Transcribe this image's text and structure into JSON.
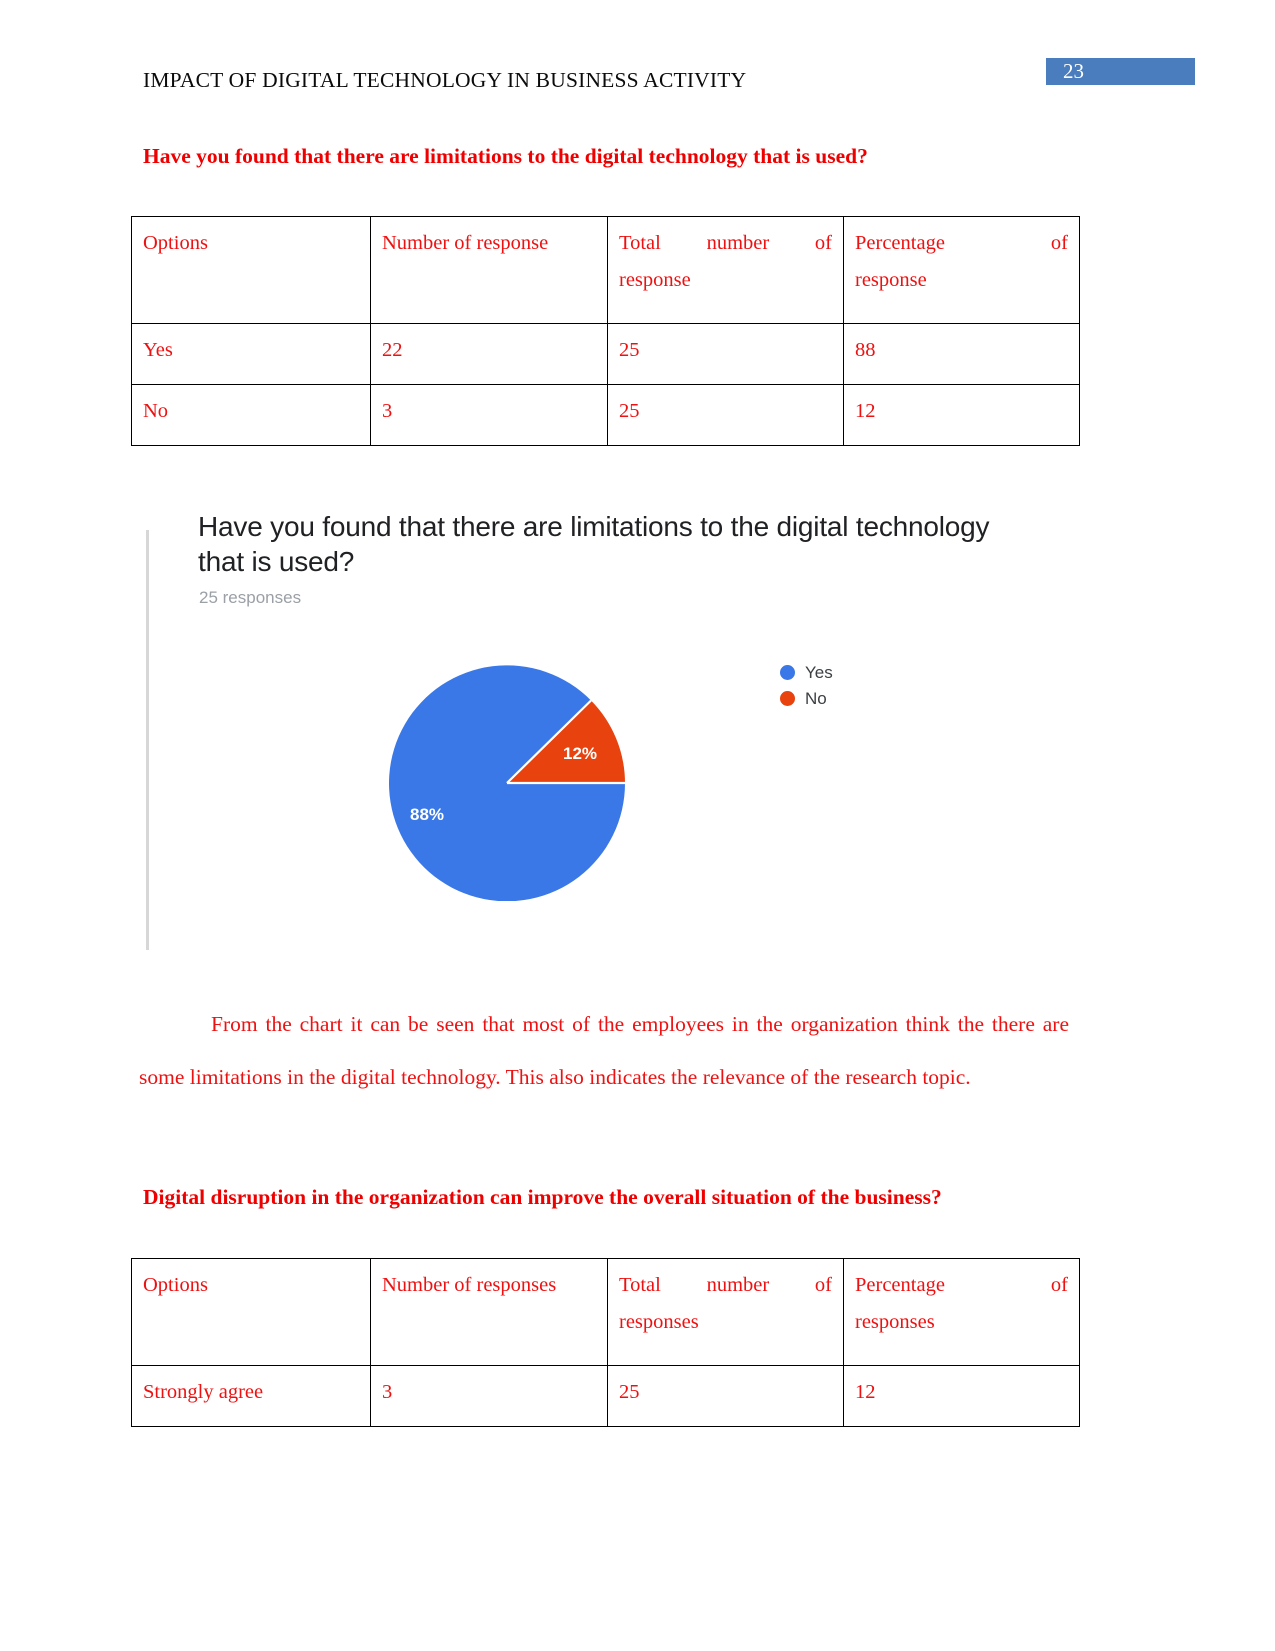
{
  "document": {
    "running_head": "IMPACT OF DIGITAL TECHNOLOGY IN BUSINESS ACTIVITY",
    "page_number": "23",
    "page_badge_color": "#4a7dbd",
    "body_text_color": "#ee1111"
  },
  "section_1": {
    "heading": "Have you found that there are limitations to the digital technology that is used?",
    "table": {
      "headers": {
        "col1": "Options",
        "col2": "Number of response",
        "col3_line1": "Total number of",
        "col3_line2": "response",
        "col4_line1": "Percentage of",
        "col4_line2": "response"
      },
      "rows": [
        {
          "option": "Yes",
          "number_of_response": "22",
          "total_number": "25",
          "percentage": "88"
        },
        {
          "option": "No",
          "number_of_response": "3",
          "total_number": "25",
          "percentage": "12"
        }
      ]
    },
    "chart_card": {
      "question": "Have you found that there are limitations to the digital technology that is used?",
      "responses_label": "25 responses",
      "slice_label_yes": "88%",
      "slice_label_no": "12%",
      "legend": [
        {
          "label": "Yes",
          "color": "#3b78e7"
        },
        {
          "label": "No",
          "color": "#e8420e"
        }
      ]
    },
    "paragraph": "From the  chart it can be seen that most of the employees in the organization think the there are some limitations in the digital technology. This also  indicates the relevance of the research topic."
  },
  "section_2": {
    "heading": "Digital disruption in the organization can improve the overall situation of the business?",
    "table": {
      "headers": {
        "col1": "Options",
        "col2": "Number of responses",
        "col3_line1": "Total number of",
        "col3_line2": "responses",
        "col4_line1": "Percentage of",
        "col4_line2": "responses"
      },
      "rows": [
        {
          "option": "Strongly agree",
          "number_of_response": "3",
          "total_number": "25",
          "percentage": "12"
        }
      ]
    }
  },
  "chart_data": {
    "type": "pie",
    "title": "Have you found that there are limitations to the digital technology that is used?",
    "subtitle": "25 responses",
    "categories": [
      "Yes",
      "No"
    ],
    "values": [
      22,
      3
    ],
    "percentages": [
      88,
      12
    ],
    "data_labels": [
      "88%",
      "12%"
    ],
    "colors": [
      "#3b78e7",
      "#e8420e"
    ],
    "legend_position": "right",
    "total": 25
  }
}
